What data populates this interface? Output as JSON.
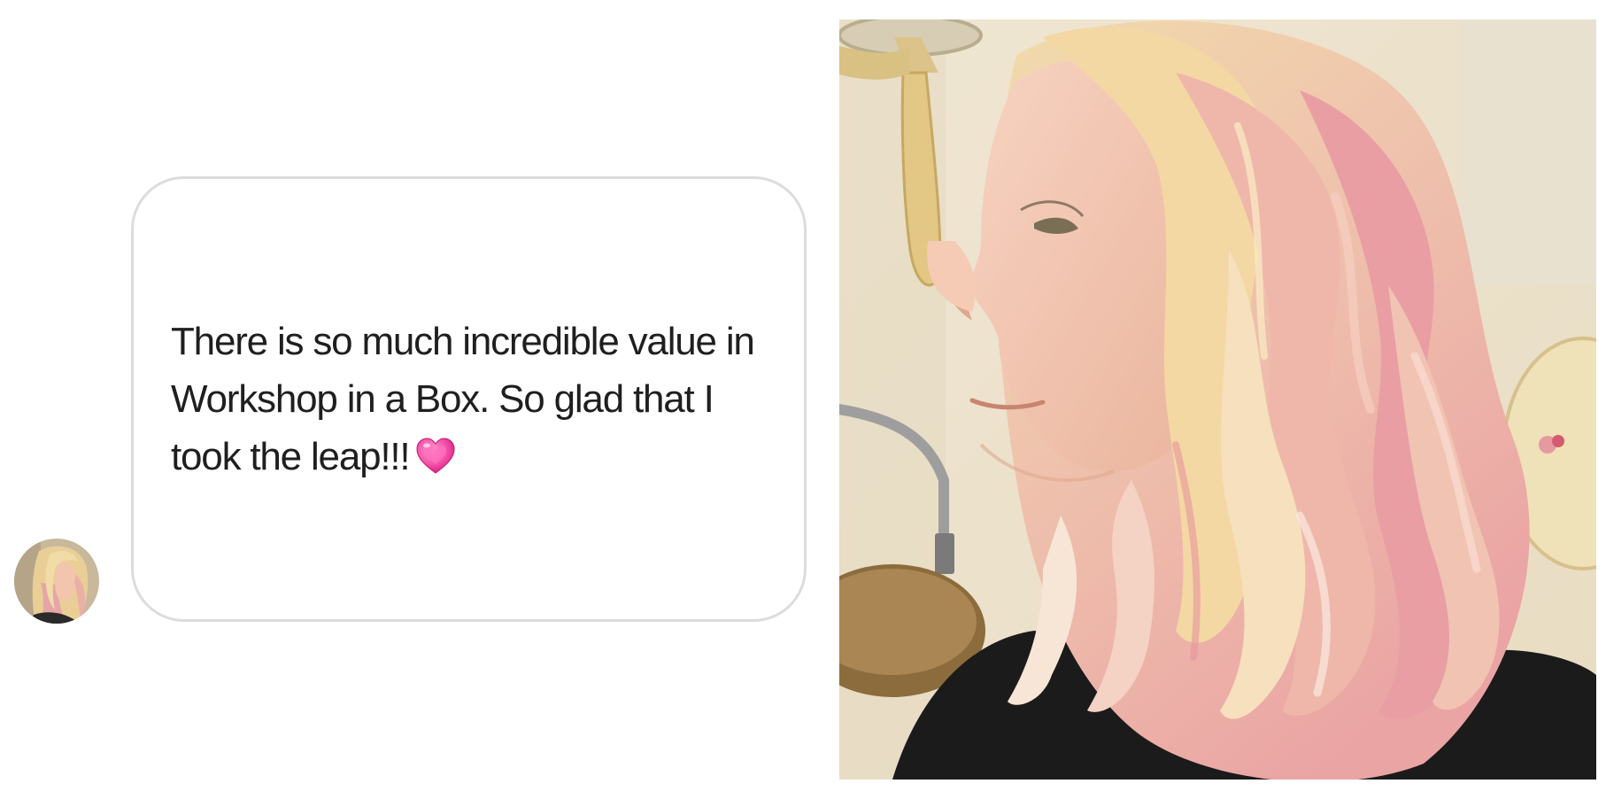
{
  "testimonial": {
    "message": "There is so much incredible value in Workshop in a Box. So glad that I took the leap!!!",
    "emoji": "heart-emoji",
    "author_avatar": "avatar-photo",
    "photo": "customer-hair-photo"
  },
  "colors": {
    "bubble_border": "#dcdcdc",
    "text": "#1f1f1f",
    "heart": "#f24ea6"
  }
}
